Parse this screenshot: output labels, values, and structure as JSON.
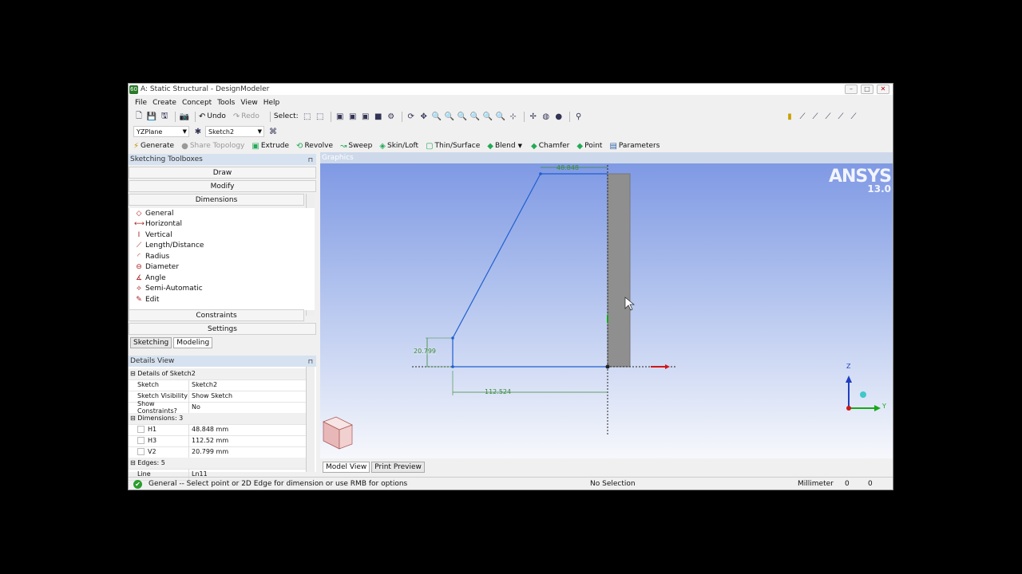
{
  "window": {
    "title": "A: Static Structural - DesignModeler",
    "app_icon": "60"
  },
  "menu": [
    "File",
    "Create",
    "Concept",
    "Tools",
    "View",
    "Help"
  ],
  "toolbar": {
    "undo": "Undo",
    "redo": "Redo",
    "select": "Select:"
  },
  "plane_bar": {
    "plane": "YZPlane",
    "sketch": "Sketch2"
  },
  "features": {
    "generate": "Generate",
    "share_topology": "Share Topology",
    "extrude": "Extrude",
    "revolve": "Revolve",
    "sweep": "Sweep",
    "skin_loft": "Skin/Loft",
    "thin_surface": "Thin/Surface",
    "blend": "Blend",
    "chamfer": "Chamfer",
    "point": "Point",
    "parameters": "Parameters"
  },
  "sketching": {
    "title": "Sketching Toolboxes",
    "sections": {
      "draw": "Draw",
      "modify": "Modify",
      "dimensions": "Dimensions",
      "constraints": "Constraints",
      "settings": "Settings"
    },
    "tools": [
      "General",
      "Horizontal",
      "Vertical",
      "Length/Distance",
      "Radius",
      "Diameter",
      "Angle",
      "Semi-Automatic",
      "Edit"
    ]
  },
  "left_tabs": {
    "sketching": "Sketching",
    "modeling": "Modeling"
  },
  "details": {
    "title": "Details View",
    "header": "Details of Sketch2",
    "sketch_k": "Sketch",
    "sketch_v": "Sketch2",
    "vis_k": "Sketch Visibility",
    "vis_v": "Show Sketch",
    "cons_k": "Show Constraints?",
    "cons_v": "No",
    "dims_hdr": "Dimensions: 3",
    "h1_k": "H1",
    "h1_v": "48.848 mm",
    "h3_k": "H3",
    "h3_v": "112.52 mm",
    "v2_k": "V2",
    "v2_v": "20.799 mm",
    "edges_hdr": "Edges: 5",
    "line_k": "Line",
    "line_v": "Ln11"
  },
  "graphics": {
    "title": "Graphics",
    "logo": "ANSYS",
    "version": "13.0",
    "dim_top": "48.848",
    "dim_v": "20.799",
    "dim_h": "112.524",
    "axis_z": "Z",
    "axis_y": "Y"
  },
  "view_tabs": {
    "model_view": "Model View",
    "print_preview": "Print Preview"
  },
  "status": {
    "message": "General -- Select point or 2D Edge for dimension or use RMB for options",
    "selection": "No Selection",
    "units": "Millimeter",
    "val1": "0",
    "val2": "0"
  },
  "colors": {
    "accent_green": "#2a9d2a",
    "sketch_line": "#1f5fd0",
    "dim_color": "#3a8a3a"
  }
}
